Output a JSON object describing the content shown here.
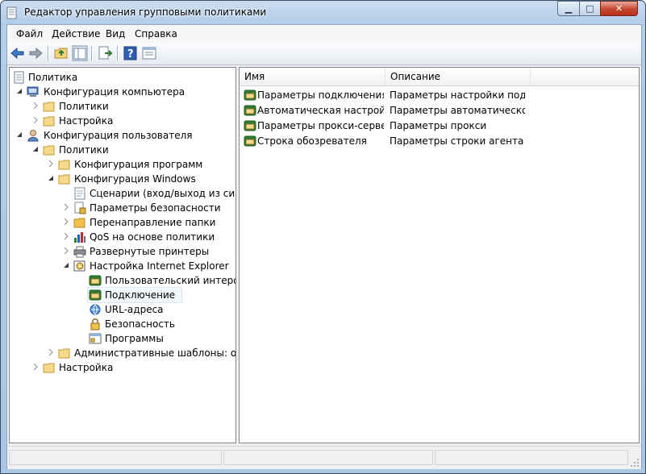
{
  "window": {
    "title": "Редактор управления групповыми политиками"
  },
  "menu": {
    "file": "Файл",
    "action": "Действие",
    "view": "Вид",
    "help": "Справка"
  },
  "toolbar": {
    "buttons": [
      "back-icon",
      "forward-icon",
      "up-folder-icon",
      "show-hide-tree-icon",
      "export-list-icon",
      "help-icon",
      "properties-icon"
    ]
  },
  "tree": {
    "root": "Политика",
    "computer_config": "Конфигурация компьютера",
    "computer_policies": "Политики",
    "computer_settings": "Настройка",
    "user_config": "Конфигурация пользователя",
    "user_policies": "Политики",
    "software_config": "Конфигурация программ",
    "windows_config": "Конфигурация Windows",
    "scripts": "Сценарии (вход/выход из систем",
    "security": "Параметры безопасности",
    "folder_redirection": "Перенаправление папки",
    "qos": "QoS на основе политики",
    "printers": "Развернутые принтеры",
    "ie_maintenance": "Настройка Internet Explorer",
    "ie_ui": "Пользовательский интерфей",
    "ie_connection": "Подключение",
    "ie_urls": "URL-адреса",
    "ie_security": "Безопасность",
    "ie_programs": "Программы",
    "admin_templates": "Административные шаблоны: опре",
    "user_settings": "Настройка"
  },
  "list": {
    "columns": {
      "name": "Имя",
      "description": "Описание"
    },
    "rows": [
      {
        "name": "Параметры подключения",
        "description": "Параметры настройки подк..."
      },
      {
        "name": "Автоматическая настройк...",
        "description": "Параметры автоматической..."
      },
      {
        "name": "Параметры прокси-сервера",
        "description": "Параметры прокси"
      },
      {
        "name": "Строка обозревателя",
        "description": "Параметры строки агента п..."
      }
    ]
  },
  "colors": {
    "accent": "#3b78c5",
    "selection_bg": "#f3f8fc",
    "close_button": "#c7462f"
  }
}
